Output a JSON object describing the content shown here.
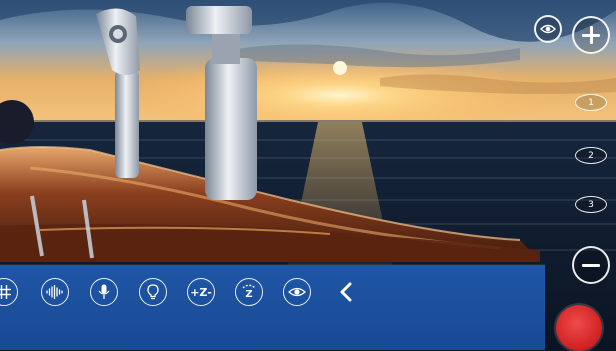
{
  "camera": {
    "presets": [
      "1",
      "2",
      "3"
    ]
  },
  "tools": [
    {
      "name": "grid",
      "icon": "grid-icon"
    },
    {
      "name": "audio-levels",
      "icon": "waveform-icon"
    },
    {
      "name": "microphone",
      "icon": "microphone-icon"
    },
    {
      "name": "light",
      "icon": "lightbulb-icon"
    },
    {
      "name": "zoom",
      "icon": "zoom-plus-minus-icon",
      "label": "+Z-"
    },
    {
      "name": "auto-zoom",
      "icon": "zoom-speed-icon",
      "label": "Z"
    },
    {
      "name": "stabilize",
      "icon": "stabilizer-eye-icon"
    }
  ],
  "colors": {
    "panel": "#1f56a6",
    "record": "#d12424",
    "control": "#ffffff"
  }
}
